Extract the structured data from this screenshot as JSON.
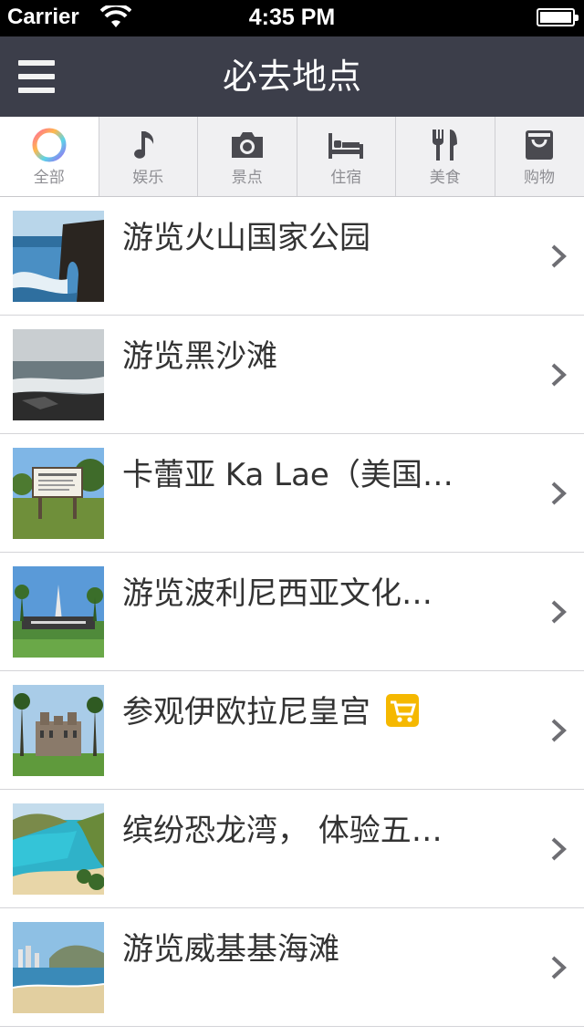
{
  "status_bar": {
    "carrier": "Carrier",
    "time": "4:35 PM"
  },
  "nav": {
    "title": "必去地点",
    "menu_icon": "hamburger-menu-icon"
  },
  "tabs": [
    {
      "label": "全部",
      "icon": "color-ring-icon",
      "active": true
    },
    {
      "label": "娱乐",
      "icon": "music-note-icon",
      "active": false
    },
    {
      "label": "景点",
      "icon": "camera-icon",
      "active": false
    },
    {
      "label": "住宿",
      "icon": "bed-icon",
      "active": false
    },
    {
      "label": "美食",
      "icon": "fork-knife-icon",
      "active": false
    },
    {
      "label": "购物",
      "icon": "shopping-bag-icon",
      "active": false
    }
  ],
  "places": [
    {
      "title": "游览火山国家公园",
      "thumb": "sea-arch-photo"
    },
    {
      "title": "游览黑沙滩",
      "thumb": "rocky-coast-photo"
    },
    {
      "title": "卡蕾亚 Ka Lae（美国…",
      "thumb": "sign-board-photo"
    },
    {
      "title": "游览波利尼西亚文化…",
      "thumb": "cultural-center-photo"
    },
    {
      "title": "参观伊欧拉尼皇宫",
      "thumb": "palace-photo",
      "badge": "shopping-cart-icon"
    },
    {
      "title": "缤纷恐龙湾， 体验五…",
      "thumb": "bay-photo"
    },
    {
      "title": "游览威基基海滩",
      "thumb": "beach-photo"
    }
  ],
  "colors": {
    "nav_bg": "#3c3e4a",
    "tab_bg": "#f0f0f2",
    "tab_label": "#8e8e93",
    "cart_badge": "#f5b800"
  }
}
